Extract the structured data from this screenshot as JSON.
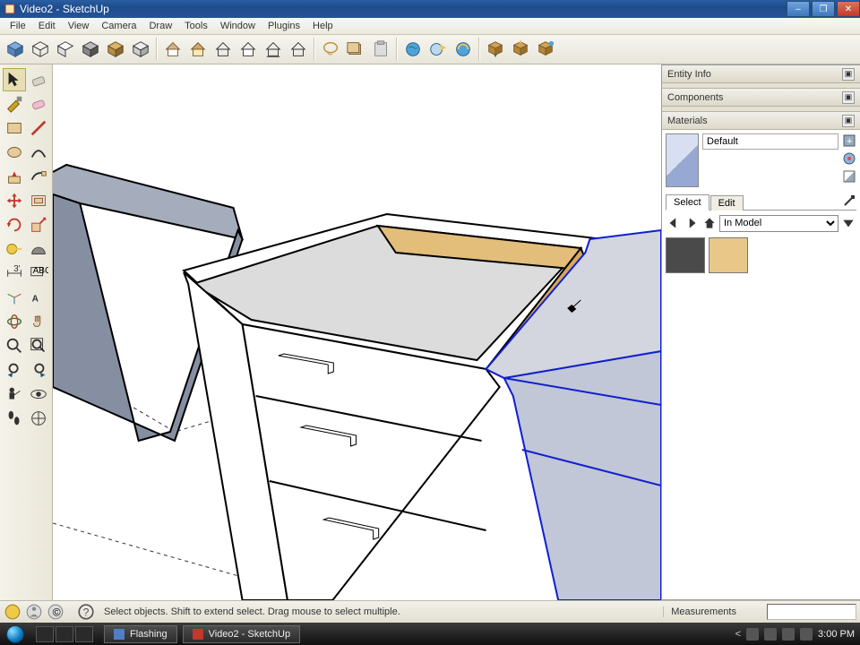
{
  "window": {
    "title": "Video2 - SketchUp"
  },
  "menu": [
    "File",
    "Edit",
    "View",
    "Camera",
    "Draw",
    "Tools",
    "Window",
    "Plugins",
    "Help"
  ],
  "status": {
    "hint": "Select objects. Shift to extend select. Drag mouse to select multiple.",
    "measurements_label": "Measurements"
  },
  "panels": {
    "entity_info": "Entity Info",
    "components": "Components",
    "materials": "Materials"
  },
  "materials": {
    "current_name": "Default",
    "tabs": {
      "select": "Select",
      "edit": "Edit"
    },
    "library": "In Model"
  },
  "taskbar": {
    "tasks": [
      {
        "label": "Flashing"
      },
      {
        "label": "Video2 - SketchUp"
      }
    ],
    "clock": "3:00 PM"
  }
}
